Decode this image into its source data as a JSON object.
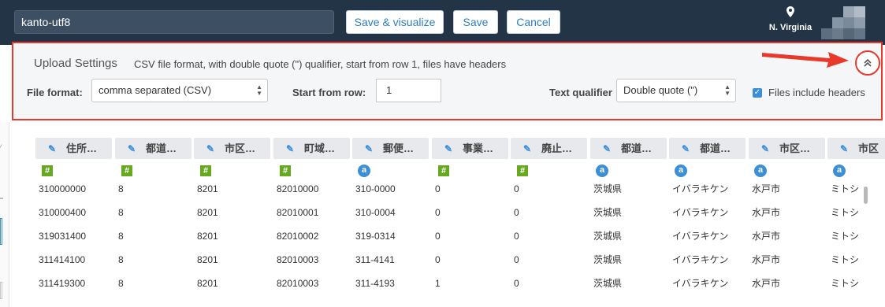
{
  "header": {
    "dataset_name": "kanto-utf8",
    "save_visualize_label": "Save & visualize",
    "save_label": "Save",
    "cancel_label": "Cancel",
    "region_icon": "map-pin-icon",
    "region_label": "N. Virginia"
  },
  "upload_settings": {
    "title": "Upload Settings",
    "description": "CSV file format, with double quote (\") qualifier, start from row 1, files have headers",
    "file_format_label": "File format:",
    "file_format_value": "comma separated (CSV)",
    "start_row_label": "Start from row:",
    "start_row_value": "1",
    "text_qualifier_label": "Text qualifier",
    "text_qualifier_value": "Double quote (\")",
    "headers_checkbox_label": "Files include headers",
    "headers_checked": true,
    "collapse_icon": "chevron-double-up-icon"
  },
  "annotation": {
    "arrow_color": "#e8392b"
  },
  "table": {
    "columns": [
      {
        "label": "住所…",
        "type": "#"
      },
      {
        "label": "都道…",
        "type": "#"
      },
      {
        "label": "市区…",
        "type": "#"
      },
      {
        "label": "町域…",
        "type": "#"
      },
      {
        "label": "郵便…",
        "type": "a"
      },
      {
        "label": "事業…",
        "type": "#"
      },
      {
        "label": "廃止…",
        "type": "#"
      },
      {
        "label": "都道…",
        "type": "a"
      },
      {
        "label": "都道…",
        "type": "a"
      },
      {
        "label": "市区…",
        "type": "a"
      },
      {
        "label": "市区",
        "type": "a"
      }
    ],
    "rows": [
      [
        "310000000",
        "8",
        "8201",
        "82010000",
        "310-0000",
        "0",
        "0",
        "茨城県",
        "イバラキケン",
        "水戸市",
        "ミトシ"
      ],
      [
        "310000400",
        "8",
        "8201",
        "82010001",
        "310-0004",
        "0",
        "0",
        "茨城県",
        "イバラキケン",
        "水戸市",
        "ミトシ"
      ],
      [
        "319031400",
        "8",
        "8201",
        "82010002",
        "319-0314",
        "0",
        "0",
        "茨城県",
        "イバラキケン",
        "水戸市",
        "ミトシ"
      ],
      [
        "311414100",
        "8",
        "8201",
        "82010003",
        "311-4141",
        "0",
        "0",
        "茨城県",
        "イバラキケン",
        "水戸市",
        "ミトシ"
      ],
      [
        "311419300",
        "8",
        "8201",
        "82010003",
        "311-4193",
        "1",
        "0",
        "茨城県",
        "イバラキケン",
        "水戸市",
        "ミトシ"
      ]
    ]
  },
  "colors": {
    "topbar": "#233447",
    "accent": "#2e7fbf",
    "highlight": "#e8392b",
    "numeric_type": "#66a820",
    "string_type": "#3b8ed8"
  }
}
